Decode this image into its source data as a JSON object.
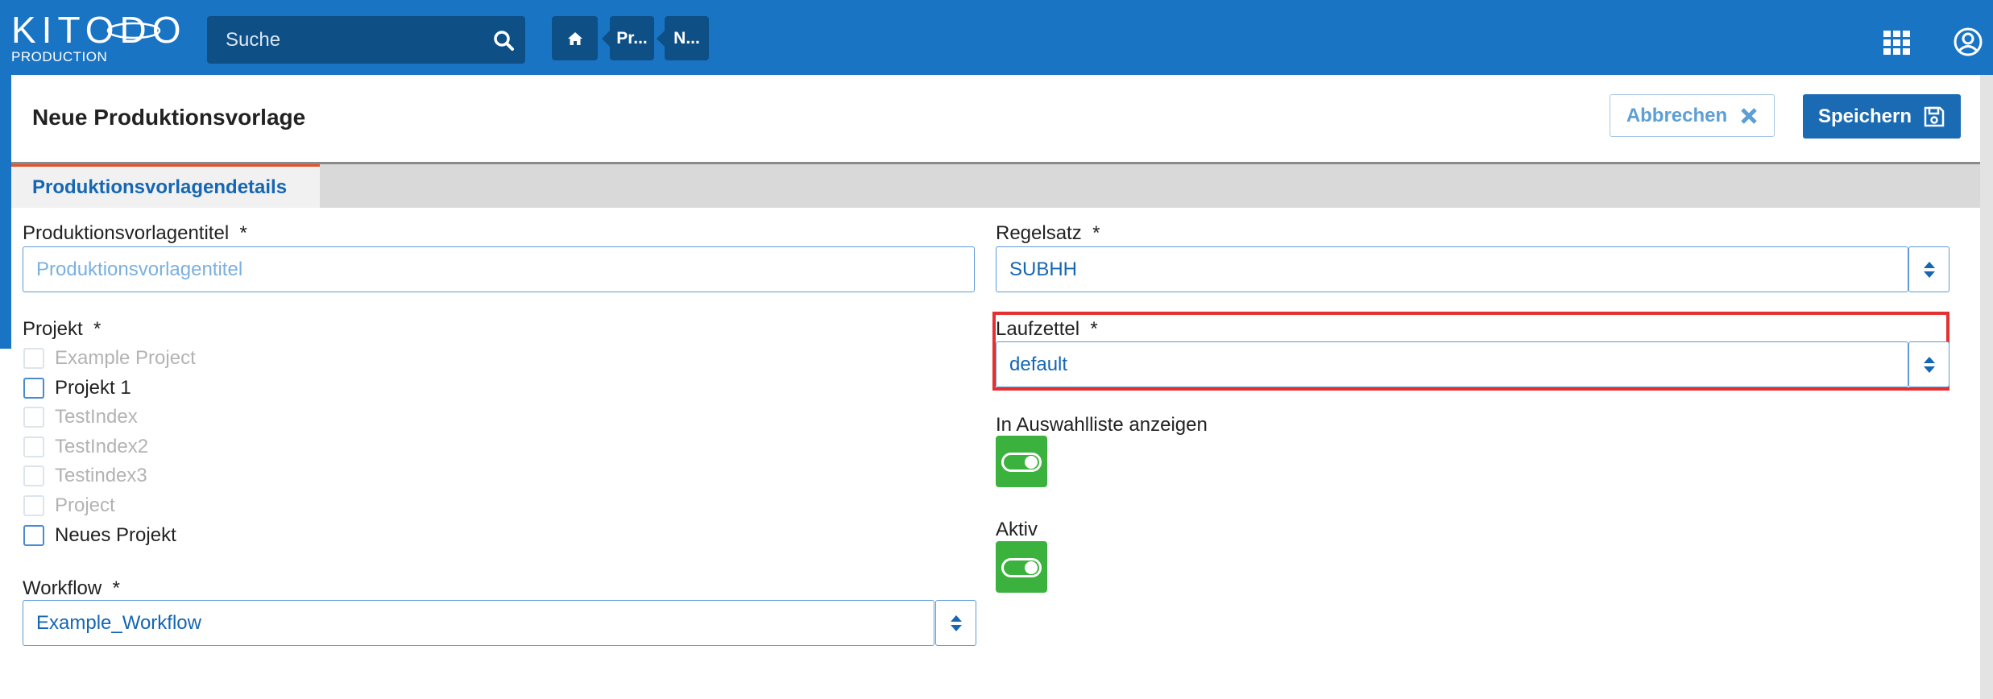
{
  "app": {
    "logo_text": "KITODO",
    "logo_subtitle": "PRODUCTION"
  },
  "search": {
    "placeholder": "Suche"
  },
  "breadcrumbs": [
    {
      "label": "home",
      "icon": "home-icon"
    },
    {
      "label": "Pr..."
    },
    {
      "label": "N..."
    }
  ],
  "header": {
    "title": "Neue Produktionsvorlage",
    "cancel_label": "Abbrechen",
    "save_label": "Speichern"
  },
  "tabs": [
    {
      "label": "Produktionsvorlagendetails",
      "active": true
    }
  ],
  "form": {
    "title_label": "Produktionsvorlagentitel",
    "title_placeholder": "Produktionsvorlagentitel",
    "title_value": "",
    "projects_label": "Projekt",
    "projects": [
      {
        "label": "Example Project",
        "checked": false,
        "disabled": true
      },
      {
        "label": "Projekt 1",
        "checked": false,
        "disabled": false
      },
      {
        "label": "TestIndex",
        "checked": false,
        "disabled": true
      },
      {
        "label": "TestIndex2",
        "checked": false,
        "disabled": true
      },
      {
        "label": "Testindex3",
        "checked": false,
        "disabled": true
      },
      {
        "label": "Project",
        "checked": false,
        "disabled": true
      },
      {
        "label": "Neues Projekt",
        "checked": false,
        "disabled": false
      }
    ],
    "workflow_label": "Workflow",
    "workflow_value": "Example_Workflow",
    "ruleset_label": "Regelsatz",
    "ruleset_value": "SUBHH",
    "docket_label": "Laufzettel",
    "docket_value": "default",
    "show_in_selection_label": "In Auswahlliste anzeigen",
    "show_in_selection_on": true,
    "active_label": "Aktiv",
    "active_on": true,
    "required_marker": "*"
  },
  "colors": {
    "topbar": "#1a74c4",
    "primary": "#1a6bb3",
    "toggle_on": "#3ab23d",
    "tab_accent": "#e4542e",
    "highlight": "#e53030"
  }
}
